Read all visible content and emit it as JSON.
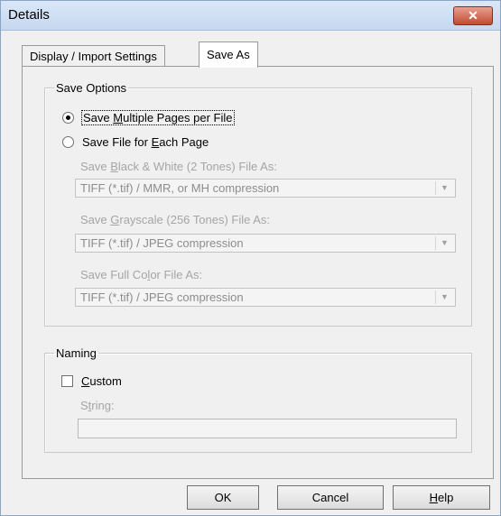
{
  "window": {
    "title": "Details",
    "close_glyph": "✕"
  },
  "tabs": [
    {
      "label": "Display / Import Settings",
      "active": false
    },
    {
      "label": "Save As",
      "active": true
    }
  ],
  "save_options": {
    "legend": "Save Options",
    "radio_multi": {
      "pre": "Save ",
      "ul": "M",
      "post": "ultiple Pages per File",
      "checked": true
    },
    "radio_each": {
      "pre": "Save File for ",
      "ul": "E",
      "post": "ach Page",
      "checked": false
    },
    "bw": {
      "pre": "Save ",
      "ul": "B",
      "post": "lack & White (2 Tones) File As:",
      "value": "TIFF (*.tif) / MMR, or MH compression"
    },
    "gray": {
      "pre": "Save ",
      "ul": "G",
      "post": "rayscale (256 Tones) File As:",
      "value": "TIFF (*.tif) / JPEG compression"
    },
    "color": {
      "pre": "Save Full Co",
      "ul": "l",
      "post": "or File As:",
      "value": "TIFF (*.tif) / JPEG compression"
    }
  },
  "naming": {
    "legend": "Naming",
    "custom": {
      "ul": "C",
      "post": "ustom",
      "checked": false
    },
    "string": {
      "pre": "S",
      "ul": "t",
      "post": "ring:",
      "value": ""
    }
  },
  "buttons": {
    "ok": "OK",
    "cancel": "Cancel",
    "help": {
      "ul": "H",
      "post": "elp"
    }
  },
  "icons": {
    "dropdown": "chevron-down-icon",
    "close": "close-icon"
  }
}
